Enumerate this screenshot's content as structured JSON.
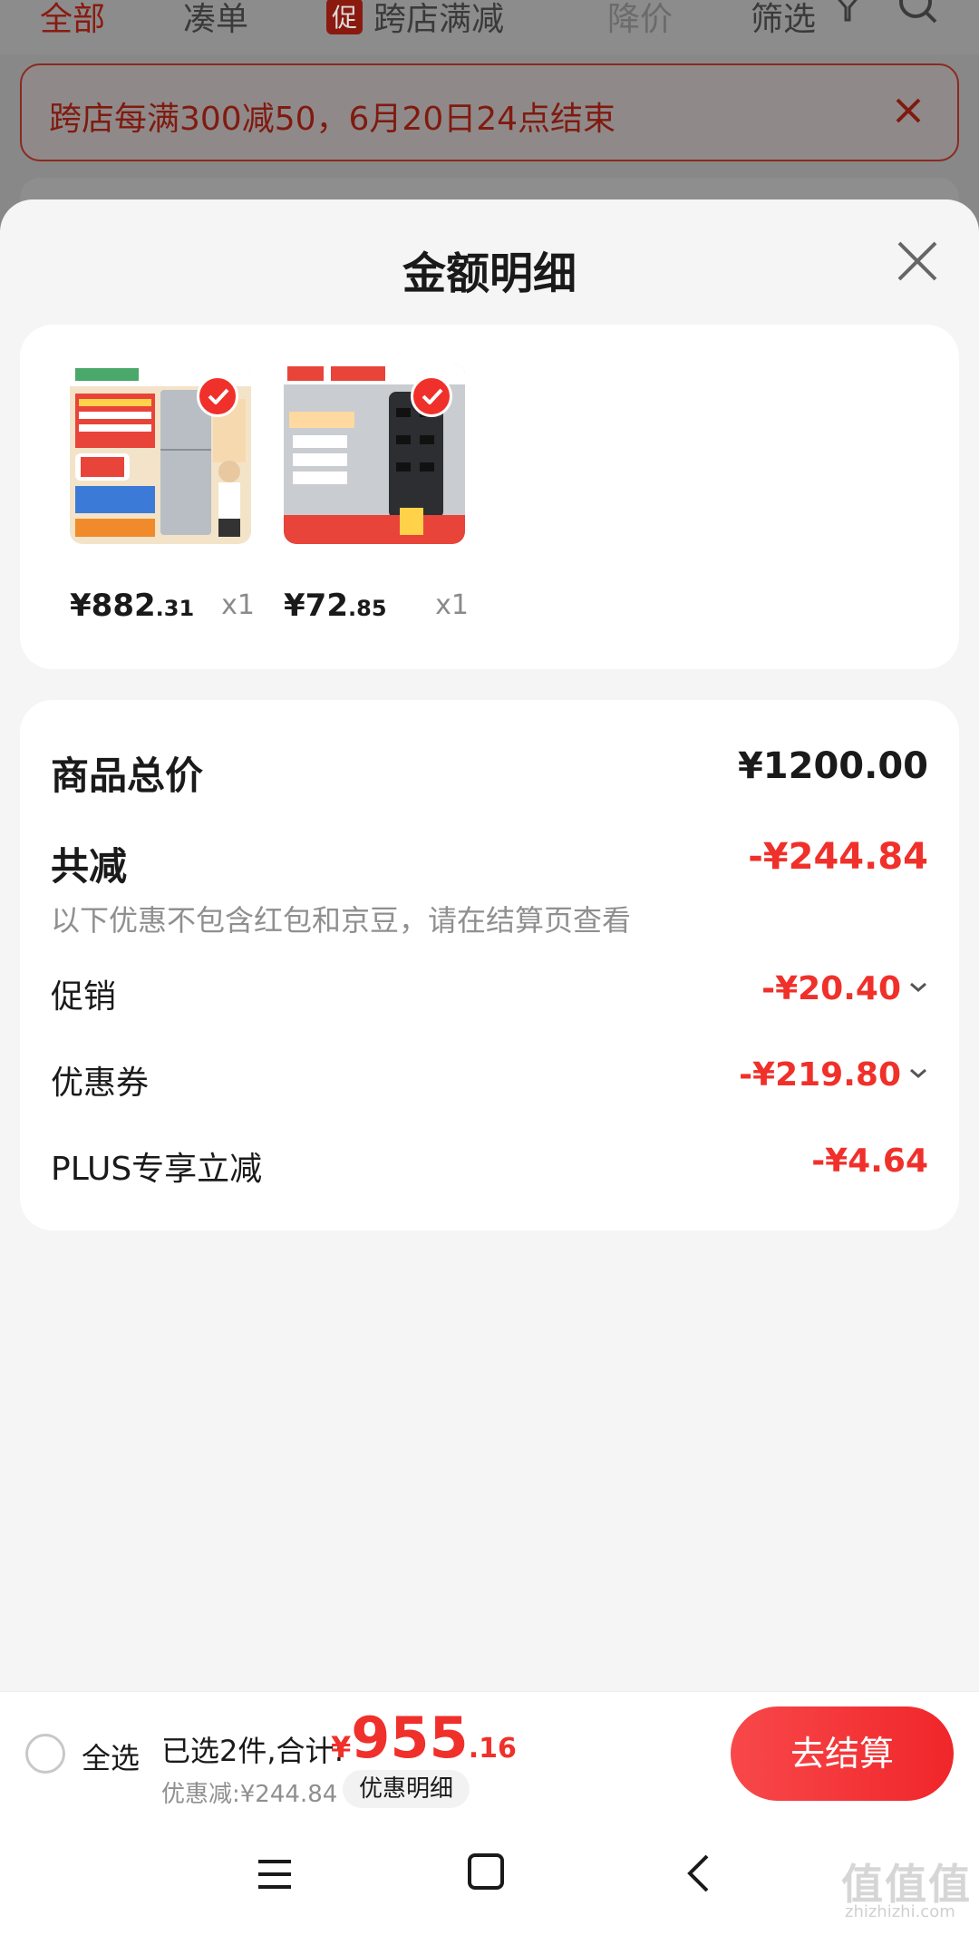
{
  "background": {
    "tabs": [
      {
        "label": "全部"
      },
      {
        "label": "凑单"
      },
      {
        "badge": "促",
        "label": "跨店满减"
      },
      {
        "label": "降价"
      },
      {
        "label": "筛选"
      }
    ],
    "banner_text": "跨店每满300减50，6月20日24点结束"
  },
  "sheet": {
    "title": "金额明细",
    "products": [
      {
        "price_symbol": "¥",
        "price_int": "882",
        "price_dec": ".31",
        "qty": "x1",
        "thumb_icon": "refrigerator-image"
      },
      {
        "price_symbol": "¥",
        "price_int": "72",
        "price_dec": ".85",
        "qty": "x1",
        "thumb_icon": "power-strip-image"
      }
    ],
    "summary": {
      "total_label": "商品总价",
      "total_value": "¥1200.00",
      "reduce_label": "共减",
      "reduce_value": "-¥244.84",
      "note": "以下优惠不包含红包和京豆，请在结算页查看",
      "promo_label": "促销",
      "promo_value": "-¥20.40",
      "coupon_label": "优惠券",
      "coupon_value": "-¥219.80",
      "plus_label": "PLUS专享立减",
      "plus_value": "-¥4.64"
    }
  },
  "bottom_bar": {
    "select_all": "全选",
    "selected_text": "已选2件,合计:",
    "total_symbol": "¥",
    "total_int": "955",
    "total_dec": ".16",
    "discount_text": "优惠减:¥244.84",
    "detail_chip": "优惠明细",
    "checkout": "去结算"
  },
  "watermark": {
    "text": "值值值",
    "url": "zhizhizhi.com"
  },
  "colors": {
    "accent_red": "#f0302a",
    "sheet_bg": "#f5f5f5",
    "card_bg": "#ffffff"
  }
}
